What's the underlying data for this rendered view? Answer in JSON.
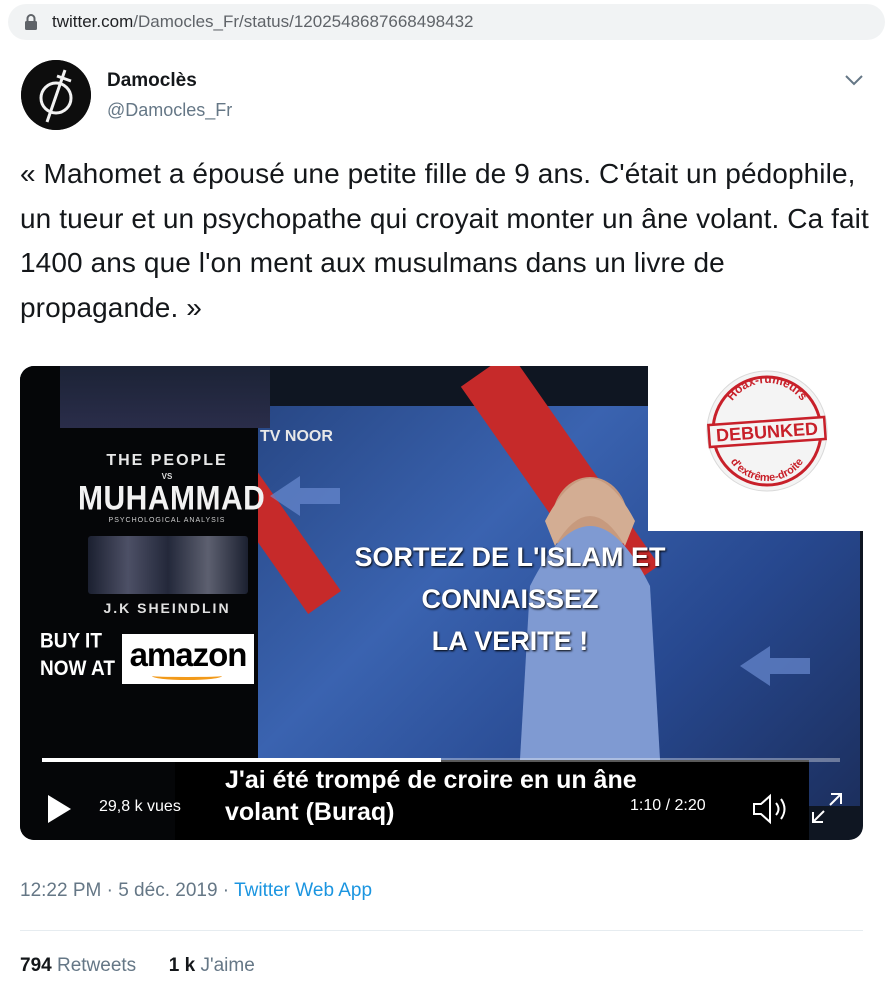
{
  "address_bar": {
    "domain": "twitter.com",
    "path": "/Damocles_Fr/status/1202548687668498432"
  },
  "tweet": {
    "author_name": "Damoclès",
    "author_handle": "@Damocles_Fr",
    "text": "« Mahomet a épousé une petite fille de 9 ans. C'était un pédophile, un tueur et un psychopathe qui croyait monter un âne volant. Ca fait 1400 ans que l'on ment aux musulmans dans un livre de propagande. »",
    "timestamp": "12:22 PM · 5 déc. 2019 · ",
    "source_app": "Twitter Web App",
    "retweets_count": "794",
    "retweets_label": " Retweets",
    "likes_count": "1 k",
    "likes_label": " J'aime"
  },
  "video": {
    "book_title_line1": "THE PEOPLE",
    "book_title_vs": "VS",
    "book_title_line2": "MUHAMMAD",
    "book_subtitle": "PSYCHOLOGICAL ANALYSIS",
    "book_author": "J.K SHEINDLIN",
    "buy_line1": "BUY IT",
    "buy_line2": "NOW AT",
    "amazon_label": "amazon",
    "tv_logo": "TV  NOOR",
    "overlay_line1": "SORTEZ DE L'ISLAM ET",
    "overlay_line2": "CONNAISSEZ",
    "overlay_line3": "LA VERITE !",
    "subtitle_line1": "J'ai été trompé de croire en un âne",
    "subtitle_line2": "volant (Buraq)",
    "views": "29,8 k vues",
    "time": "1:10 / 2:20",
    "progress": 0.5,
    "stamp_top": "Hoax-rumeurs",
    "stamp_middle": "DEBUNKED",
    "stamp_bottom": "d'extrême-droite"
  },
  "colors": {
    "link": "#1b95e0",
    "muted": "#657786",
    "stamp_red": "#c8202a"
  }
}
